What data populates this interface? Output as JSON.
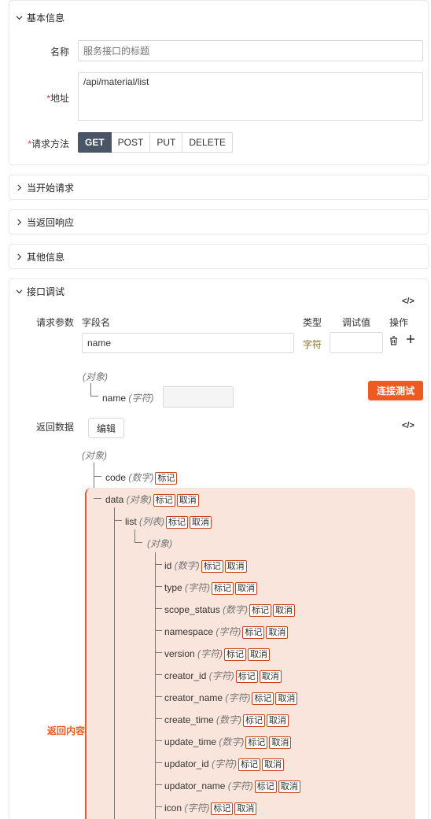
{
  "sections": {
    "basic": "基本信息",
    "on_request": "当开始请求",
    "on_response": "当返回响应",
    "other": "其他信息",
    "debug": "接口调试"
  },
  "basic": {
    "name_label": "名称",
    "name_placeholder": "服务接口的标题",
    "address_label": "地址",
    "address_value": "/api/material/list",
    "method_label": "请求方法",
    "required_mark": "*",
    "methods": [
      "GET",
      "POST",
      "PUT",
      "DELETE"
    ],
    "active_method": "GET"
  },
  "debug": {
    "code_icon": "</>",
    "params_label": "请求参数",
    "columns": {
      "field": "字段名",
      "type": "类型",
      "value": "调试值",
      "action": "操作"
    },
    "param_row": {
      "field": "name",
      "type": "字符",
      "value": ""
    },
    "param_tree": {
      "root": "(对象)",
      "child_name": "name",
      "child_type": "(字符)"
    },
    "connect_button": "连接测试",
    "return_label": "返回数据",
    "edit_button": "编辑",
    "return_content_label": "返回内容",
    "tag_mark": "标记",
    "tag_cancel": "取消",
    "tree": {
      "root": "(对象)",
      "code": {
        "name": "code",
        "type": "(数字)"
      },
      "data": {
        "name": "data",
        "type": "(对象)"
      },
      "list": {
        "name": "list",
        "type": "(列表)"
      },
      "list_obj": "(对象)",
      "fields": [
        {
          "name": "id",
          "type": "(数字)"
        },
        {
          "name": "type",
          "type": "(字符)"
        },
        {
          "name": "scope_status",
          "type": "(数字)"
        },
        {
          "name": "namespace",
          "type": "(字符)"
        },
        {
          "name": "version",
          "type": "(字符)"
        },
        {
          "name": "creator_id",
          "type": "(字符)"
        },
        {
          "name": "creator_name",
          "type": "(字符)"
        },
        {
          "name": "create_time",
          "type": "(数字)"
        },
        {
          "name": "update_time",
          "type": "(数字)"
        },
        {
          "name": "updator_id",
          "type": "(字符)"
        },
        {
          "name": "updator_name",
          "type": "(字符)"
        },
        {
          "name": "icon",
          "type": "(字符)"
        }
      ]
    }
  }
}
